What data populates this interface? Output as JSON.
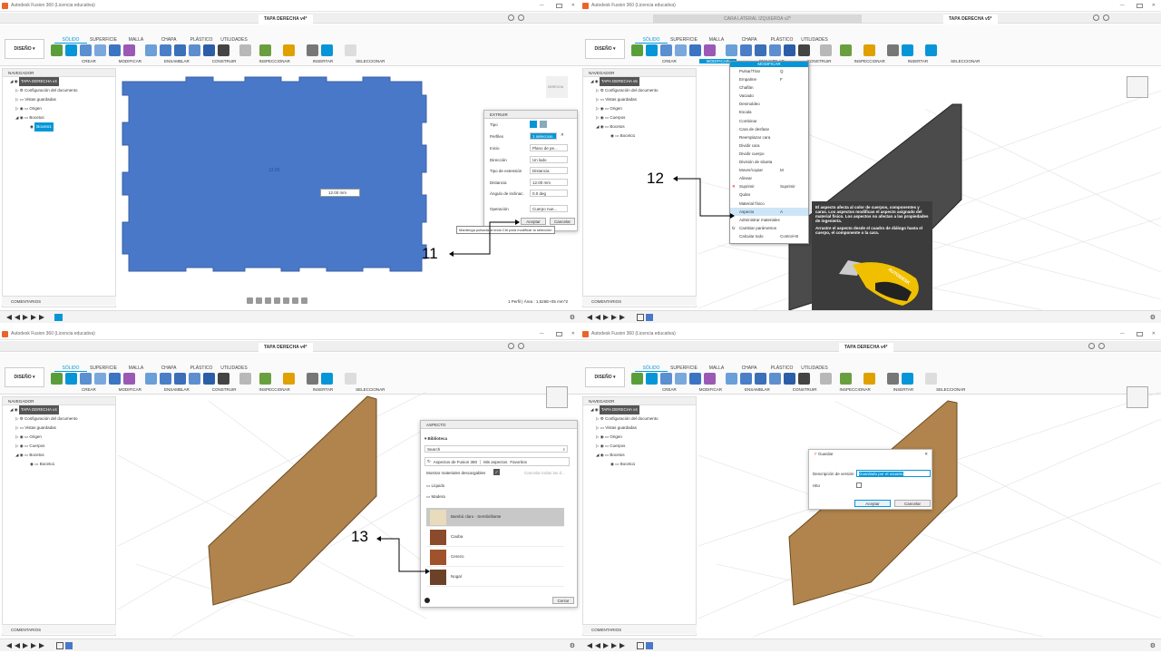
{
  "app": {
    "window_title": "Autodesk Fusion 360 (Licencia educativa)",
    "design_button": "DISEÑO",
    "ribbon_tabs": [
      "SÓLIDO",
      "SUPERFICIE",
      "MALLA",
      "CHAPA",
      "PLÁSTICO",
      "UTILIDADES"
    ],
    "groups": [
      "CREAR",
      "MODIFICAR",
      "ENSAMBLAR",
      "CONSTRUIR",
      "INSPECCIONAR",
      "INSERTAR",
      "SELECCIONAR"
    ],
    "navigator_title": "NAVEGADOR",
    "comments_label": "COMENTARIOS",
    "colors": {
      "accent": "#0696d7",
      "face": "#4a78c8",
      "wood": "#b0844c"
    }
  },
  "panels": {
    "p1": {
      "doc_tab": "TAPA DERECHA v4*",
      "tree": {
        "root": "TAPA DERECHA v4",
        "items": [
          "Configuración del documento",
          "Vistas guardadas",
          "Origen",
          "Bocetos"
        ],
        "sketch": "Boceto1"
      },
      "face_label": "12.00",
      "dim_value": "12.00 mm",
      "extrude": {
        "title": "EXTRUIR",
        "labels": [
          "Tipo",
          "Perfiles",
          "Inicio",
          "Dirección",
          "Tipo de extensión",
          "Distancia",
          "Ángulo de inclinac.",
          "Operación"
        ],
        "values": [
          "1 seleccion",
          "Plano de pe...",
          "Un lado",
          "Distancia",
          "12.00 mm",
          "0.0 deg",
          "Cuerpo nue..."
        ],
        "ok": "Aceptar",
        "cancel": "Cancelar",
        "tooltip": "Mantenga pulsada la tecla Ctrl para modificar la selección"
      },
      "status": "1 Perfil | Área : 1,526E+05 mm^2",
      "annotation": "11",
      "view_label": "DERECHA"
    },
    "p2": {
      "doc_tab_inactive": "CARA LATERAL IZQUIERDA v2*",
      "doc_tab": "TAPA DERECHA v5*",
      "tree": {
        "root": "TAPA DERECHA v5",
        "items": [
          "Configuración del documento",
          "Vistas guardadas",
          "Origen",
          "Cuerpos",
          "Bocetos"
        ],
        "sketch": "Boceto1"
      },
      "menu_title": "MODIFICAR",
      "menu": [
        {
          "label": "Pulsar/Tirar",
          "key": "Q"
        },
        {
          "label": "Empalme",
          "key": "F"
        },
        {
          "label": "Chaflán",
          "key": ""
        },
        {
          "label": "Vaciado",
          "key": ""
        },
        {
          "label": "Desmoldeo",
          "key": ""
        },
        {
          "label": "Escala",
          "key": ""
        },
        {
          "label": "Combinar",
          "key": ""
        },
        {
          "label": "Cara de desfase",
          "key": ""
        },
        {
          "label": "Reemplazar cara",
          "key": ""
        },
        {
          "label": "Dividir cara",
          "key": ""
        },
        {
          "label": "Dividir cuerpo",
          "key": ""
        },
        {
          "label": "División de silueta",
          "key": ""
        },
        {
          "label": "Mover/copiar",
          "key": "M"
        },
        {
          "label": "Alinear",
          "key": ""
        },
        {
          "label": "Suprimir",
          "key": "Suprimir"
        },
        {
          "label": "Quitar",
          "key": ""
        },
        {
          "label": "Material físico",
          "key": ""
        },
        {
          "label": "Aspecto",
          "key": "A"
        },
        {
          "label": "Administrar materiales",
          "key": ""
        },
        {
          "label": "Cambiar parámetros",
          "key": ""
        },
        {
          "label": "Calcular todo",
          "key": "Control+B"
        }
      ],
      "tooltip_text": "El aspecto afecta al color de cuerpos, componentes y caras. Los aspectos modifican el aspecto asignado del material físico. Los aspectos no afectan a las propiedades de ingeniería.",
      "tooltip_text2": "Arrastre el aspecto desde el cuadro de diálogo hasta el cuerpo, el componente o la cara.",
      "tooltip_help": "Pulse Ctrl+/ para obtener más ayuda.",
      "brand": "AUTODESK",
      "annotation": "12"
    },
    "p3": {
      "doc_tab": "TAPA DERECHA v4*",
      "tree": {
        "root": "TAPA DERECHA v4",
        "items": [
          "Configuración del documento",
          "Vistas guardadas",
          "Origen",
          "Cuerpos",
          "Bocetos"
        ],
        "sketch": "Boceto1"
      },
      "aspect": {
        "title": "ASPECTO",
        "library": "Biblioteca",
        "search_placeholder": "Search",
        "tabs": [
          "Aspectos de Fusion 360",
          "Mis aspectos",
          "Favoritos"
        ],
        "show_downloadable": "Mostrar materiales descargables",
        "cancel_downloads": "Cancelar todas las d...",
        "folders": [
          "Líquido",
          "Madera"
        ],
        "materials": [
          "Bambú claro - Semibrillante",
          "Caoba",
          "Cerezo",
          "Nogal"
        ],
        "close": "Cerrar"
      },
      "annotation": "13"
    },
    "p4": {
      "doc_tab": "TAPA DERECHA v4*",
      "tree": {
        "root": "TAPA DERECHA v4",
        "items": [
          "Configuración del documento",
          "Vistas guardadas",
          "Origen",
          "Cuerpos",
          "Bocetos"
        ],
        "sketch": "Boceto1"
      },
      "save": {
        "title": "Guardar",
        "desc_label": "Descripción de versión",
        "desc_value": "Guardado por el usuario",
        "milestone": "Hito",
        "ok": "Aceptar",
        "cancel": "Cancelar"
      }
    }
  }
}
